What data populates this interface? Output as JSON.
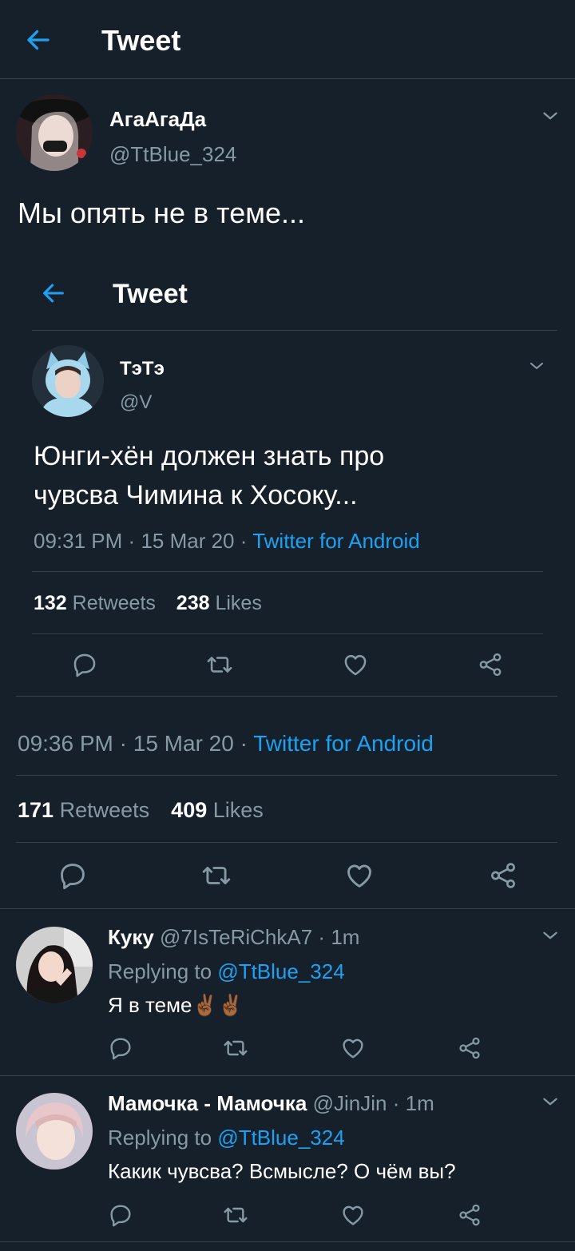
{
  "header": {
    "title": "Tweet"
  },
  "tweet": {
    "author_name": "АгаАгаДа",
    "author_handle": "@TtBlue_324",
    "text": "Мы опять не в теме...",
    "time": "09:36 PM",
    "date": "15 Mar 20",
    "source": "Twitter for Android",
    "retweets_count": "171",
    "retweets_label": "Retweets",
    "likes_count": "409",
    "likes_label": "Likes"
  },
  "quoted": {
    "header_title": "Tweet",
    "author_name": "ТэТэ",
    "author_handle": "@V",
    "text_line1": "Юнги-хён должен знать про",
    "text_line2": "чувсва Чимина к Хосоку...",
    "time": "09:31 PM",
    "date": "15 Mar 20",
    "source": "Twitter for Android",
    "retweets_count": "132",
    "retweets_label": "Retweets",
    "likes_count": "238",
    "likes_label": "Likes"
  },
  "replies": [
    {
      "name": "Куку",
      "handle": "@7IsTeRiChkA7",
      "age": "1m",
      "replying_prefix": "Replying to",
      "replying_handle": "@TtBlue_324",
      "text": "Я в теме✌🏾✌🏾"
    },
    {
      "name": "Мамочка - Мамочка",
      "handle": "@JinJin",
      "age": "1m",
      "replying_prefix": "Replying to",
      "replying_handle": "@TtBlue_324",
      "text": "Какик чувсва? Всмысле? О чём вы?"
    }
  ],
  "separator": "·",
  "colors": {
    "background": "#15202b",
    "accent": "#1da1f2",
    "secondary": "#8899a6",
    "divider": "#38444d"
  },
  "icons": [
    "back-arrow-icon",
    "chevron-down-icon",
    "reply-icon",
    "retweet-icon",
    "like-icon",
    "share-icon"
  ]
}
